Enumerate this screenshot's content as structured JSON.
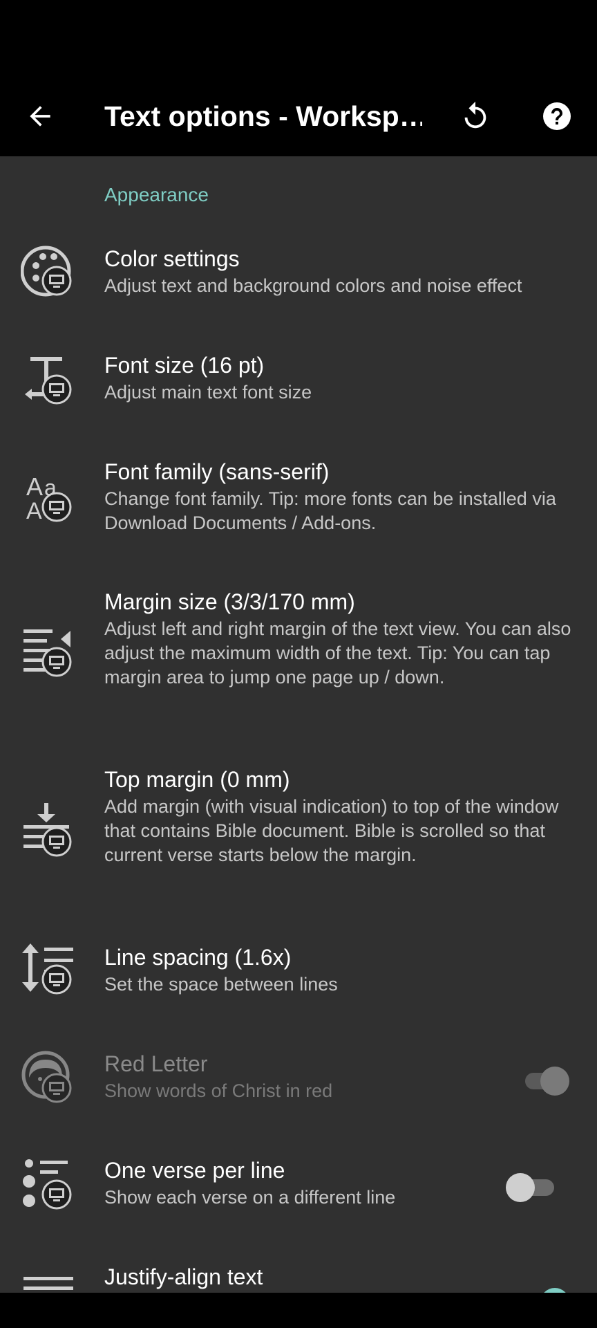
{
  "app_bar": {
    "title": "Text options - Worksp…",
    "back_icon": "arrow-left-icon",
    "reset_icon": "reset-icon",
    "help_icon": "help-circle-icon"
  },
  "section": {
    "header": "Appearance"
  },
  "prefs": [
    {
      "title": "Color settings",
      "summary": "Adjust text and background colors and noise effect",
      "icon": "palette-icon"
    },
    {
      "title": "Font size (16 pt)",
      "summary": "Adjust main text font size",
      "icon": "font-size-icon"
    },
    {
      "title": "Font family (sans-serif)",
      "summary": "Change font family. Tip: more fonts can be installed via Download Documents / Add-ons.",
      "icon": "font-family-icon"
    },
    {
      "title": "Margin size (3/3/170 mm)",
      "summary": "Adjust left and right margin of the text view. You can also adjust the maximum width of the text. Tip: You can tap margin area to jump one page up / down.",
      "icon": "margin-icon"
    },
    {
      "title": "Top margin (0 mm)",
      "summary": "Add margin (with visual indication) to top of the window that contains Bible document. Bible is scrolled so that current verse starts below the margin.",
      "icon": "top-margin-icon"
    },
    {
      "title": "Line spacing (1.6x)",
      "summary": "Set the space between lines",
      "icon": "line-spacing-icon"
    },
    {
      "title": "Red Letter",
      "summary": "Show words of Christ in red",
      "icon": "christ-face-icon",
      "toggle": true,
      "disabled": true
    },
    {
      "title": "One verse per line",
      "summary": "Show each verse on a different line",
      "icon": "list-icon",
      "toggle": false
    },
    {
      "title": "Justify-align text",
      "summary": "",
      "icon": "justify-icon",
      "toggle": true
    }
  ],
  "colors": {
    "accent": "#7fcdc4",
    "background": "#303030",
    "bar": "#000000"
  }
}
